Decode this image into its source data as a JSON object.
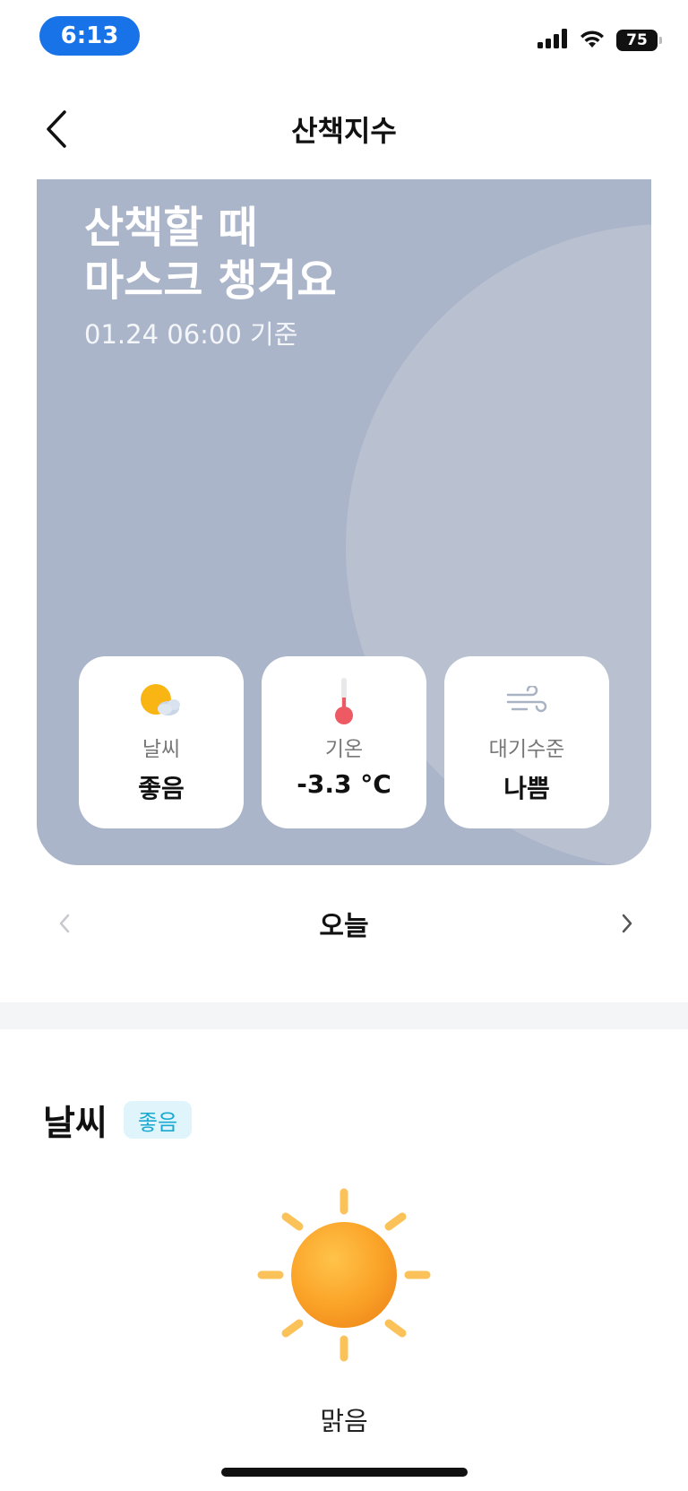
{
  "status_bar": {
    "time": "6:13",
    "battery": "75"
  },
  "header": {
    "title": "산책지수"
  },
  "hero": {
    "headline": "산책할 때\n마스크 챙겨요",
    "timestamp": "01.24 06:00 기준",
    "bg_color": "#abb5ca"
  },
  "cards": [
    {
      "icon": "partly-sunny-icon",
      "label": "날씨",
      "value": "좋음"
    },
    {
      "icon": "thermometer-icon",
      "label": "기온",
      "value": "-3.3 °C"
    },
    {
      "icon": "wind-icon",
      "label": "대기수준",
      "value": "나쁨"
    }
  ],
  "day_nav": {
    "label": "오늘"
  },
  "weather_section": {
    "title": "날씨",
    "badge": "좋음",
    "badge_color": "#17a9cf",
    "condition_icon": "sun-icon",
    "condition": "맑음"
  }
}
